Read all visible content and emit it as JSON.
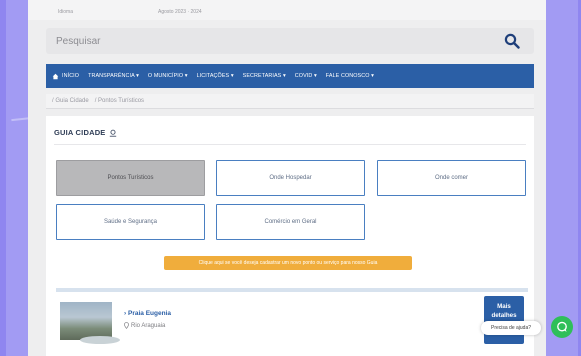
{
  "top_strip": {
    "left_text": "Idioma",
    "right_text": "Agosto 2023 · 2024"
  },
  "search": {
    "placeholder": "Pesquisar"
  },
  "nav": {
    "items": [
      {
        "label": "INÍCIO"
      },
      {
        "label": "TRANSPARÊNCIA ▾"
      },
      {
        "label": "O MUNICÍPIO ▾"
      },
      {
        "label": "LICITAÇÕES ▾"
      },
      {
        "label": "SECRETARIAS ▾"
      },
      {
        "label": "COVID ▾"
      },
      {
        "label": "FALE CONOSCO ▾"
      }
    ]
  },
  "breadcrumb": {
    "first": "/  Guia Cidade",
    "second": "/  Pontos Turísticos"
  },
  "guide": {
    "title": "GUIA CIDADE",
    "buttons": [
      {
        "label": "Pontos Turísticos"
      },
      {
        "label": "Onde Hospedar"
      },
      {
        "label": "Onde comer"
      },
      {
        "label": "Saúde e Segurança"
      },
      {
        "label": "Comércio em Geral"
      }
    ],
    "notice": "Clique aqui se você deseja cadastrar um novo ponto ou serviço para nosso Guia"
  },
  "attraction": {
    "name": "Praia Eugenia",
    "location": "Rio Araguaia",
    "details_label": "Mais detalhes"
  },
  "help": {
    "label": "Precisa de ajuda?"
  },
  "colors": {
    "nav": "#2b5fa6",
    "notice": "#f0ad3c",
    "chat": "#2fbf59",
    "background": "#a29bf3"
  }
}
